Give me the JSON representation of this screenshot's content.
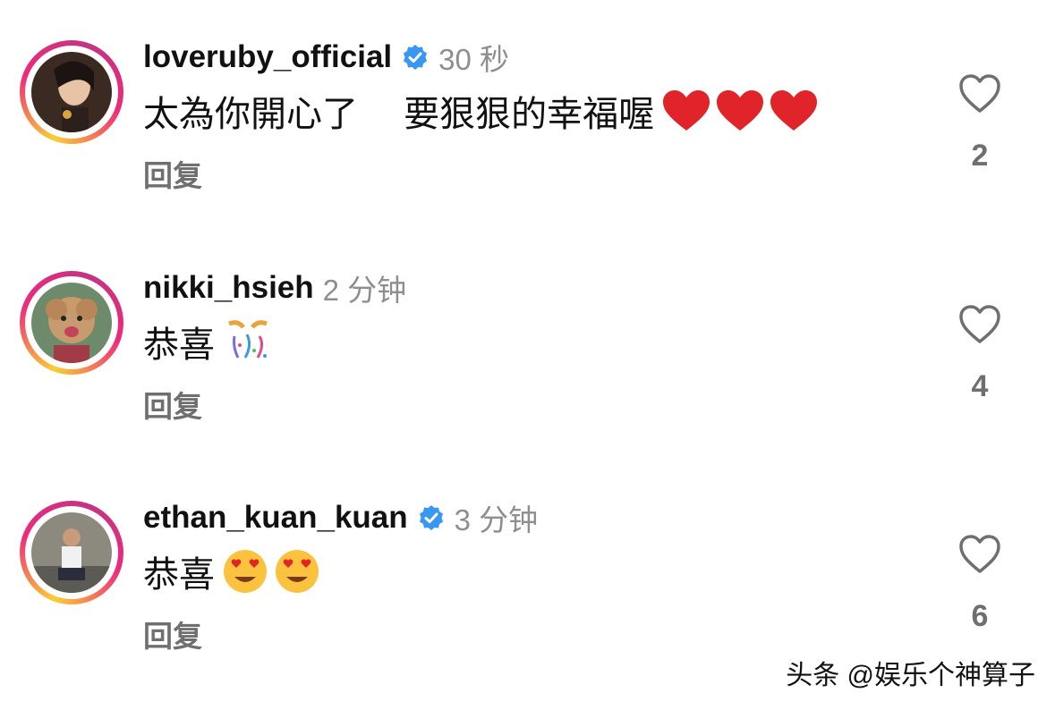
{
  "comments": [
    {
      "username": "loveruby_official",
      "verified": true,
      "time": "30 秒",
      "text": "太為你開心了　 要狠狠的幸福喔",
      "emoji": "heart-emoji x3",
      "reply_label": "回复",
      "likes": "2"
    },
    {
      "username": "nikki_hsieh",
      "verified": false,
      "time": "2 分钟",
      "text": "恭喜",
      "emoji": "party-popper-emoji",
      "reply_label": "回复",
      "likes": "4"
    },
    {
      "username": "ethan_kuan_kuan",
      "verified": true,
      "time": "3 分钟",
      "text": "恭喜",
      "emoji": "heart-eyes-emoji x2",
      "reply_label": "回复",
      "likes": "6"
    }
  ],
  "watermark": "头条 @娱乐个神算子",
  "colors": {
    "verified_blue": "#3897f0",
    "muted_text": "#8e8e8e",
    "heart_red": "#e0242a"
  }
}
